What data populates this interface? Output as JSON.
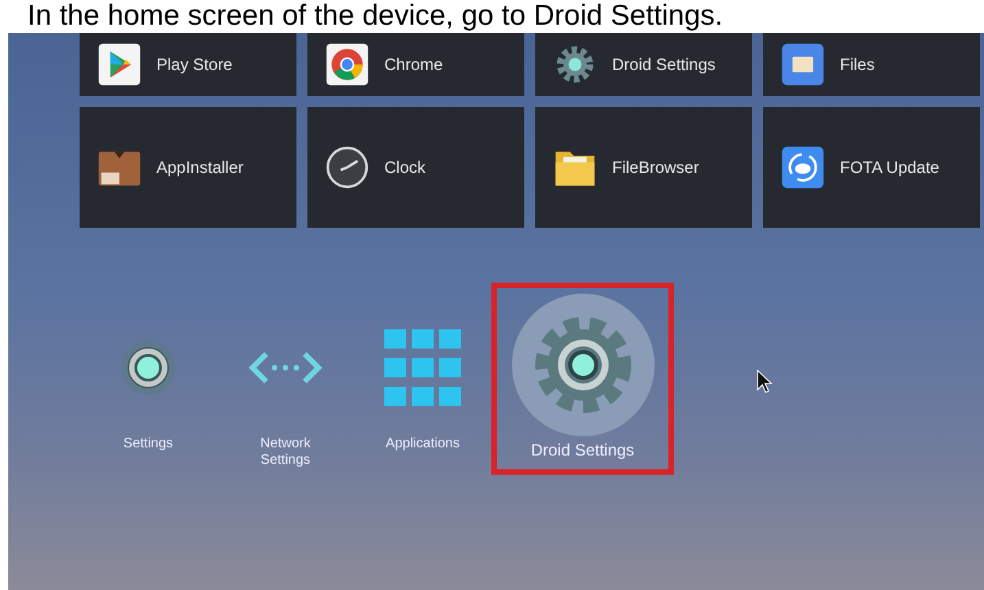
{
  "caption": "In the home screen of the device, go to Droid Settings.",
  "apps": [
    {
      "label": "Play Store",
      "kind": "play"
    },
    {
      "label": "Chrome",
      "kind": "chrome"
    },
    {
      "label": "Droid Settings",
      "kind": "gear"
    },
    {
      "label": "Files",
      "kind": "files"
    },
    {
      "label": "AppInstaller",
      "kind": "installer"
    },
    {
      "label": "Clock",
      "kind": "clock"
    },
    {
      "label": "FileBrowser",
      "kind": "folder"
    },
    {
      "label": "FOTA Update",
      "kind": "fota"
    }
  ],
  "dock": [
    {
      "label": "Settings",
      "kind": "settings",
      "selected": false
    },
    {
      "label": "Network\nSettings",
      "kind": "network",
      "selected": false
    },
    {
      "label": "Applications",
      "kind": "grid",
      "selected": false
    },
    {
      "label": "Droid Settings",
      "kind": "droid",
      "selected": true
    }
  ]
}
